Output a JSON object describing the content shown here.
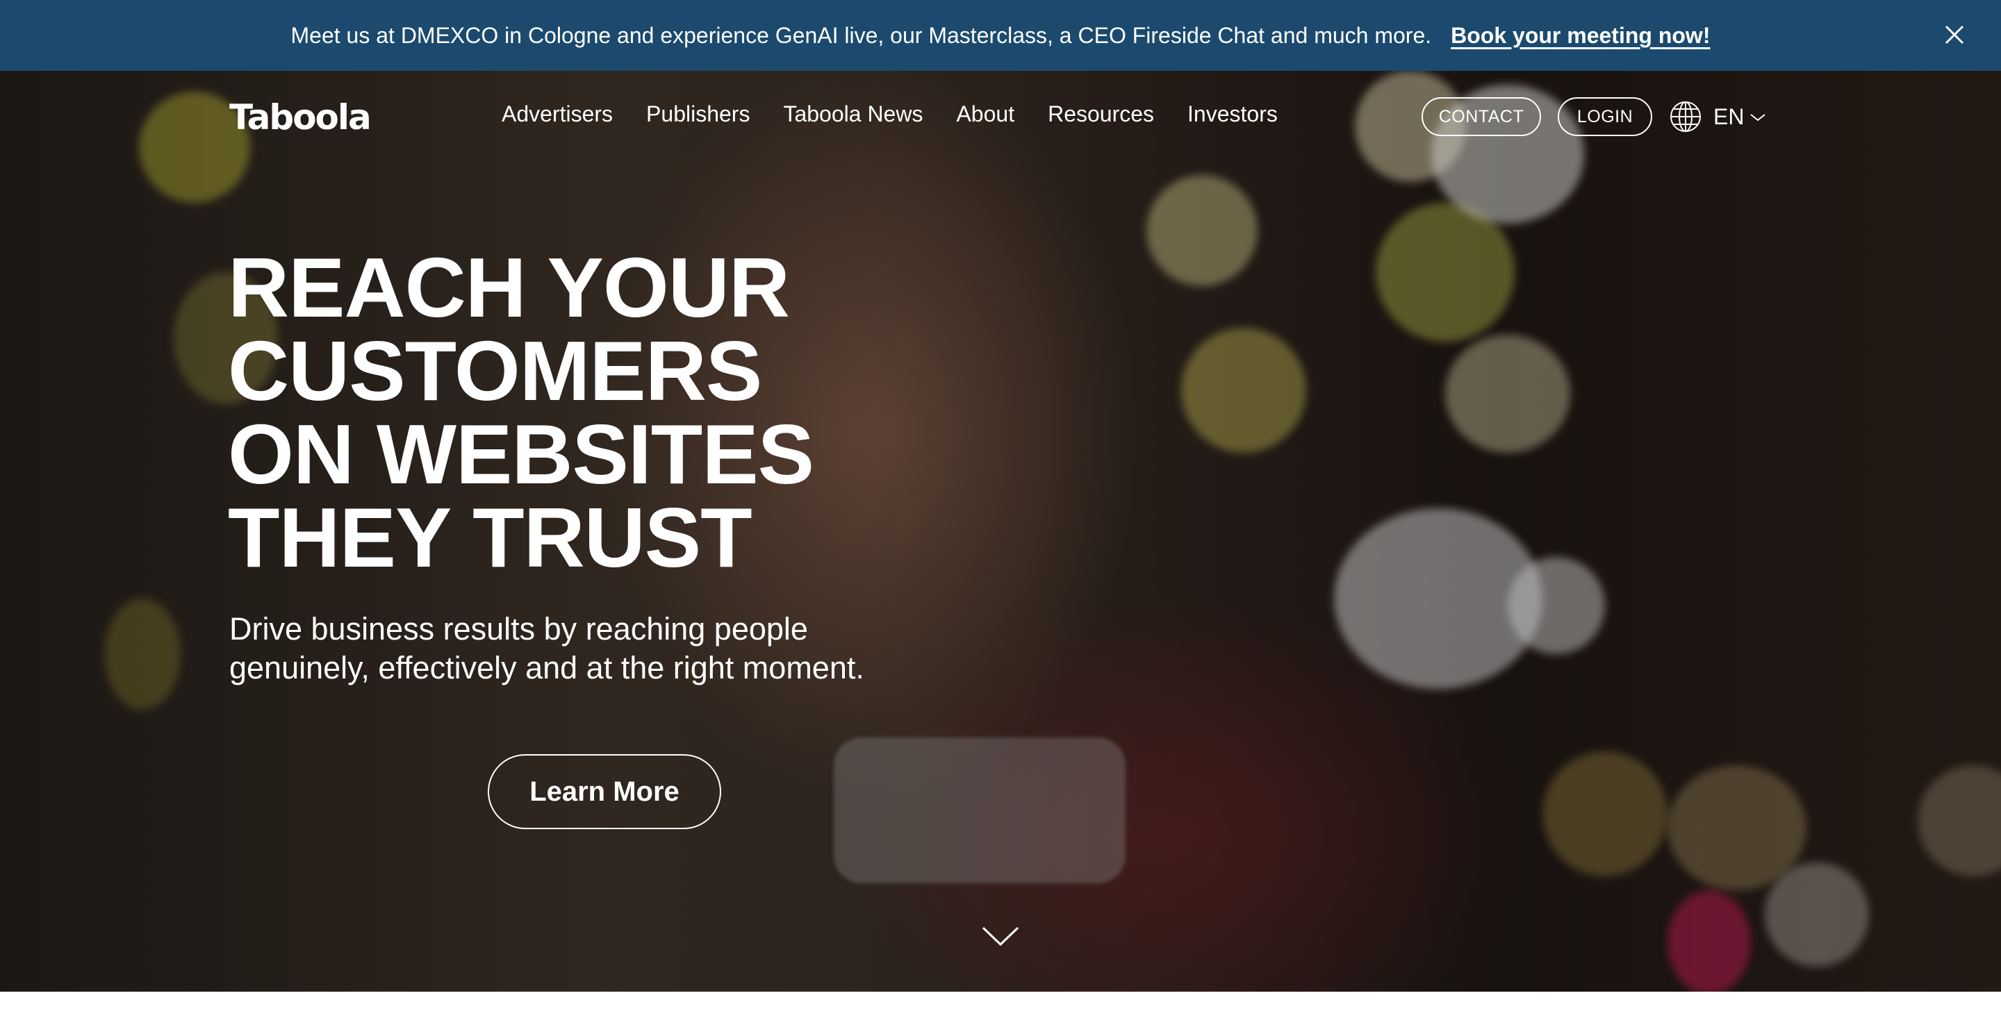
{
  "banner": {
    "text": "Meet us at DMEXCO in Cologne and experience GenAI live, our Masterclass, a CEO Fireside Chat and much more.",
    "link": "Book your meeting now!",
    "close_icon": "close-icon",
    "background_color": "#1b4a6e"
  },
  "header": {
    "logo": "Taboola",
    "nav": [
      "Advertisers",
      "Publishers",
      "Taboola News",
      "About",
      "Resources",
      "Investors"
    ],
    "contact_label": "CONTACT",
    "login_label": "LOGIN",
    "globe_icon": "globe-icon",
    "language": "EN",
    "language_chevron_icon": "chevron-down-icon"
  },
  "hero": {
    "headline": [
      "REACH YOUR",
      "CUSTOMERS",
      "ON WEBSITES",
      "THEY TRUST"
    ],
    "subtext": "Drive business results by reaching people genuinely, effectively and at the right moment.",
    "cta_label": "Learn More",
    "scroll_icon": "chevron-down-icon"
  }
}
